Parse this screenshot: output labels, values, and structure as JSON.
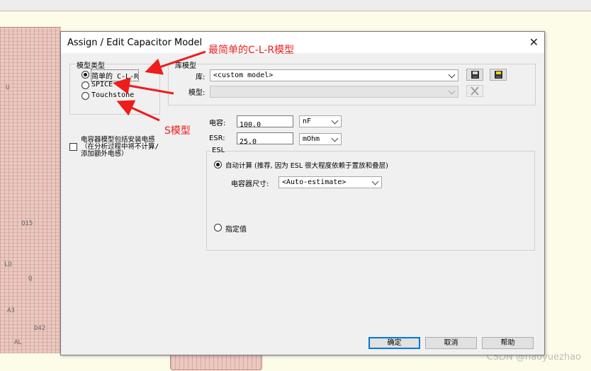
{
  "background": {
    "pcb_labels": [
      "U",
      "Q15",
      "LD",
      "Q",
      "A3",
      "D42",
      "AL"
    ],
    "watermark": "CSDN @haoyuezhao"
  },
  "dialog": {
    "title": "Assign / Edit Capacitor Model",
    "model_type": {
      "group_label": "模型类型",
      "options": [
        "简单的 C-L-R",
        "SPICE",
        "Touchstone"
      ],
      "selected": "简单的 C-L-R"
    },
    "include_mounting": {
      "label": "电容器模型包括安装电感（在分析过程中将不计算/添加额外电感）",
      "checked": false
    },
    "library": {
      "group_label": "库模型",
      "lib_label": "库:",
      "lib_value": "<custom model>",
      "model_label": "模型:",
      "model_value": ""
    },
    "values": {
      "capacitance_label": "电容:",
      "capacitance_value": "100.0",
      "capacitance_unit": "nF",
      "esr_label": "ESR:",
      "esr_value": "25.0",
      "esr_unit": "mOhm"
    },
    "esl": {
      "group_label": "ESL",
      "auto_label": "自动计算 (推荐, 因为 ESL 很大程度依赖于置放和叠层)",
      "auto_selected": true,
      "size_label": "电容器尺寸:",
      "size_value": "<Auto-estimate>",
      "manual_label": "指定值",
      "manual_selected": false
    },
    "buttons": {
      "ok": "确定",
      "cancel": "取消",
      "help": "帮助"
    }
  },
  "annotations": {
    "simple_model": "最简单的C-L-R模型",
    "s_model": "S模型",
    "color": "#ee1c1c"
  }
}
